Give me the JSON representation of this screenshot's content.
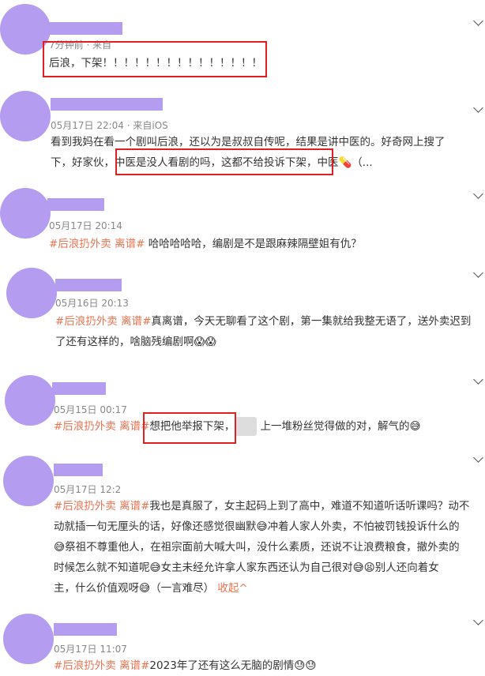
{
  "comments": [
    {
      "time": "7分钟前 · 来自",
      "line1": "后浪，下架！！！！！！！！！！！！！！！"
    },
    {
      "time": "05月17日 22:04 · 来自iOS",
      "line1": "看到我妈在看一个剧叫后浪，还以为是叔叔自传呢，结果是讲中医的。好奇网上搜了",
      "line2a": "下，好家伙，",
      "line2b": "中医是没人看剧的吗，这都不给投诉下架，",
      "line2c": "中医💊（..."
    },
    {
      "time": "05月17日 20:14",
      "tag": "#后浪扔外卖 离谱#",
      "text": " 哈哈哈哈哈，编剧是不是跟麻辣隔壁姐有仇？"
    },
    {
      "time": "05月16日 20:13",
      "tag": "#后浪扔外卖 离谱#",
      "text": "真离谱，今天无聊看了这个剧，第一集就给我整无语了，送外卖迟到",
      "line2": "了还有这样的，啥脑残编剧啊😱😱"
    },
    {
      "time": "05月15日 00:17",
      "tag": "#后浪扔外卖 离谱#",
      "boxed": "想把他举报下架，",
      "text": " 上一堆粉丝觉得做的对，解气的😅"
    },
    {
      "time": "05月17日 12:2",
      "tag": "#后浪扔外卖 离谱#",
      "text": "我也是真服了，女主起码上到了高中，难道不知道听话听课吗？动不",
      "line2": "动就插一句无厘头的话，好像还感觉很幽默😅冲着人家人外卖，不怕被罚钱投诉什么的",
      "line3": "😅祭祖不尊重他人，在祖宗面前大喊大叫，没什么素质，还说不让浪费粮食，撤外卖的",
      "line4": "时候怎么就不知道呢😅女主未经允许拿人家东西还认为自己很对😅😫别人还向着女",
      "line5a": "主，什么价值观呀😅（一言难尽） ",
      "line5b": "收起^"
    },
    {
      "time": "05月17日 11:07",
      "tag": "#后浪扔外卖 离谱#",
      "text": "2023年了还有这么无脑的剧情😓😓"
    }
  ]
}
